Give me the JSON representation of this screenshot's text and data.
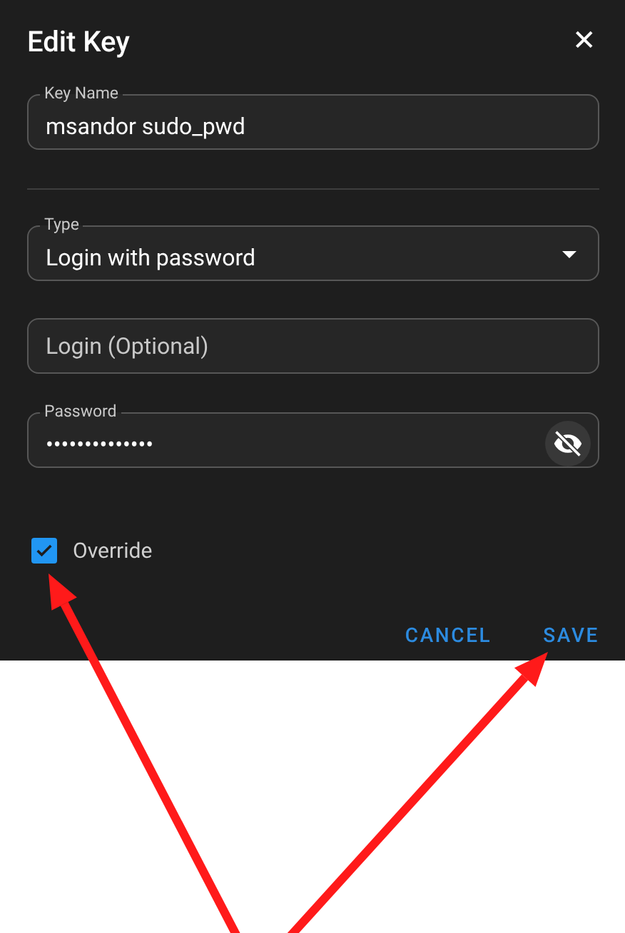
{
  "dialog": {
    "title": "Edit Key",
    "close_glyph": "✕"
  },
  "fields": [
    {
      "kind": "text",
      "label": "Key Name",
      "value": "msandor sudo_pwd"
    },
    {
      "kind": "divider"
    },
    {
      "kind": "select",
      "label": "Type",
      "value": "Login with password"
    },
    {
      "kind": "text",
      "placeholder": "Login (Optional)"
    },
    {
      "kind": "password",
      "label": "Password",
      "value": "••••••••••••••",
      "revealed": false
    }
  ],
  "override": {
    "label": "Override",
    "checked": true
  },
  "buttons": [
    {
      "label": "CANCEL"
    },
    {
      "label": "SAVE"
    }
  ]
}
